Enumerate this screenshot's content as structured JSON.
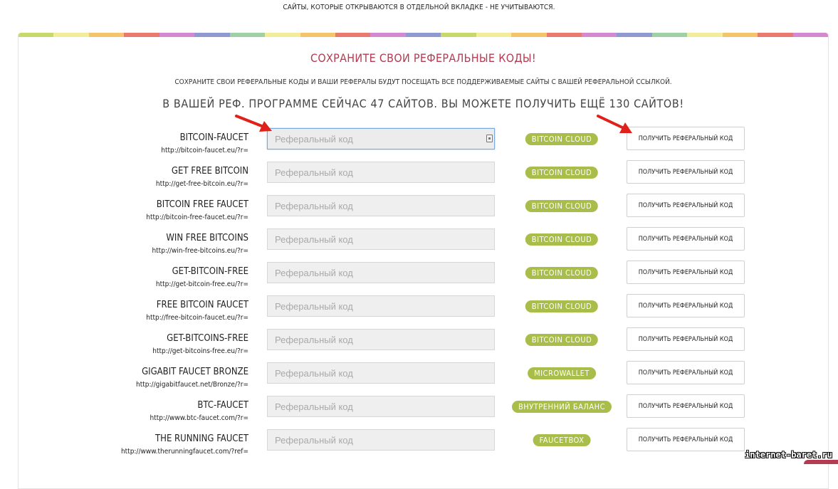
{
  "notice": "САЙТЫ, КОТОРЫЕ ОТКРЫВАЮТСЯ В ОТДЕЛЬНОЙ ВКЛАДКЕ - НЕ УЧИТЫВАЮТСЯ.",
  "stripe_colors": [
    "#c9d86b",
    "#f2ec9b",
    "#f5c56b",
    "#ea7a6f",
    "#d48ad1",
    "#8f9bd0",
    "#9fd0a6",
    "#f2ec9b",
    "#f5c56b",
    "#ea7a6f",
    "#d48ad1",
    "#8f9bd0",
    "#c9d86b",
    "#f2ec9b",
    "#f5c56b",
    "#ea7a6f",
    "#d48ad1",
    "#8f9bd0",
    "#9fd0a6",
    "#f2ec9b",
    "#f5c56b",
    "#ea7a6f",
    "#d48ad1"
  ],
  "panel": {
    "title": "СОХРАНИТЕ СВОИ РЕФЕРАЛЬНЫЕ КОДЫ!",
    "subtitle": "СОХРАНИТЕ СВОИ РЕФЕРАЛЬНЫЕ КОДЫ И ВАШИ РЕФЕРАЛЫ БУДУТ ПОСЕЩАТЬ ВСЕ ПОДДЕРЖИВАЕМЫЕ САЙТЫ С ВАШЕЙ РЕФЕРАЛЬНОЙ ССЫЛКОЙ.",
    "count_text": "В ВАШЕЙ РЕФ. ПРОГРАММЕ СЕЙЧАС 47 САЙТОВ. ВЫ МОЖЕТЕ ПОЛУЧИТЬ ЕЩЁ 130 САЙТОВ!",
    "title_color": "#b33b52",
    "badge_color": "#a9bd4a"
  },
  "input_placeholder": "Реферальный код",
  "button_label": "ПОЛУЧИТЬ РЕФЕРАЛЬНЫЙ КОД",
  "sites": [
    {
      "name": "BITCOIN-FAUCET",
      "url": "http://bitcoin-faucet.eu/?r=",
      "payout": "BITCOIN CLOUD"
    },
    {
      "name": "GET FREE BITCOIN",
      "url": "http://get-free-bitcoin.eu/?r=",
      "payout": "BITCOIN CLOUD"
    },
    {
      "name": "BITCOIN FREE FAUCET",
      "url": "http://bitcoin-free-faucet.eu/?r=",
      "payout": "BITCOIN CLOUD"
    },
    {
      "name": "WIN FREE BITCOINS",
      "url": "http://win-free-bitcoins.eu/?r=",
      "payout": "BITCOIN CLOUD"
    },
    {
      "name": "GET-BITCOIN-FREE",
      "url": "http://get-bitcoin-free.eu/?r=",
      "payout": "BITCOIN CLOUD"
    },
    {
      "name": "FREE BITCOIN FAUCET",
      "url": "http://free-bitcoin-faucet.eu/?r=",
      "payout": "BITCOIN CLOUD"
    },
    {
      "name": "GET-BITCOINS-FREE",
      "url": "http://get-bitcoins-free.eu/?r=",
      "payout": "BITCOIN CLOUD"
    },
    {
      "name": "GIGABIT FAUCET BRONZE",
      "url": "http://gigabitfaucet.net/Bronze/?r=",
      "payout": "MICROWALLET"
    },
    {
      "name": "BTC-FAUCET",
      "url": "http://www.btc-faucet.com/?r=",
      "payout": "ВНУТРЕННИЙ БАЛАНС"
    },
    {
      "name": "THE RUNNING FAUCET",
      "url": "http://www.therunningfaucet.com/?ref=",
      "payout": "FAUCETBOX"
    }
  ],
  "watermark": "internet-baret.ru"
}
